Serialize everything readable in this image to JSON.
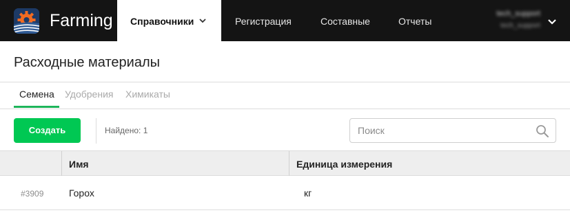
{
  "app": {
    "brand": "Farming",
    "colors": {
      "navbar_bg": "#141414",
      "accent_green": "#00c853",
      "tab_underline": "#1db45a",
      "logo_bg": "#1d3a66",
      "logo_gear": "#f26b21"
    }
  },
  "nav": {
    "items": [
      {
        "label": "Справочники",
        "active": true,
        "has_dropdown": true
      },
      {
        "label": "Регистрация",
        "active": false
      },
      {
        "label": "Составные",
        "active": false
      },
      {
        "label": "Отчеты",
        "active": false
      }
    ],
    "user": {
      "name": "tech_support",
      "subtitle": "tech_support",
      "icon": "chevron-down-icon"
    }
  },
  "page": {
    "title": "Расходные материалы"
  },
  "tabs": [
    {
      "label": "Семена",
      "active": true
    },
    {
      "label": "Удобрения",
      "active": false
    },
    {
      "label": "Химикаты",
      "active": false
    }
  ],
  "toolbar": {
    "create_label": "Создать",
    "found_text": "Найдено: 1",
    "search_placeholder": "Поиск",
    "search_value": "",
    "search_icon": "search-icon"
  },
  "table": {
    "columns": [
      "",
      "Имя",
      "Единица измерения"
    ],
    "rows": [
      {
        "id": "#3909",
        "name": "Горох",
        "unit": "кг"
      }
    ]
  }
}
